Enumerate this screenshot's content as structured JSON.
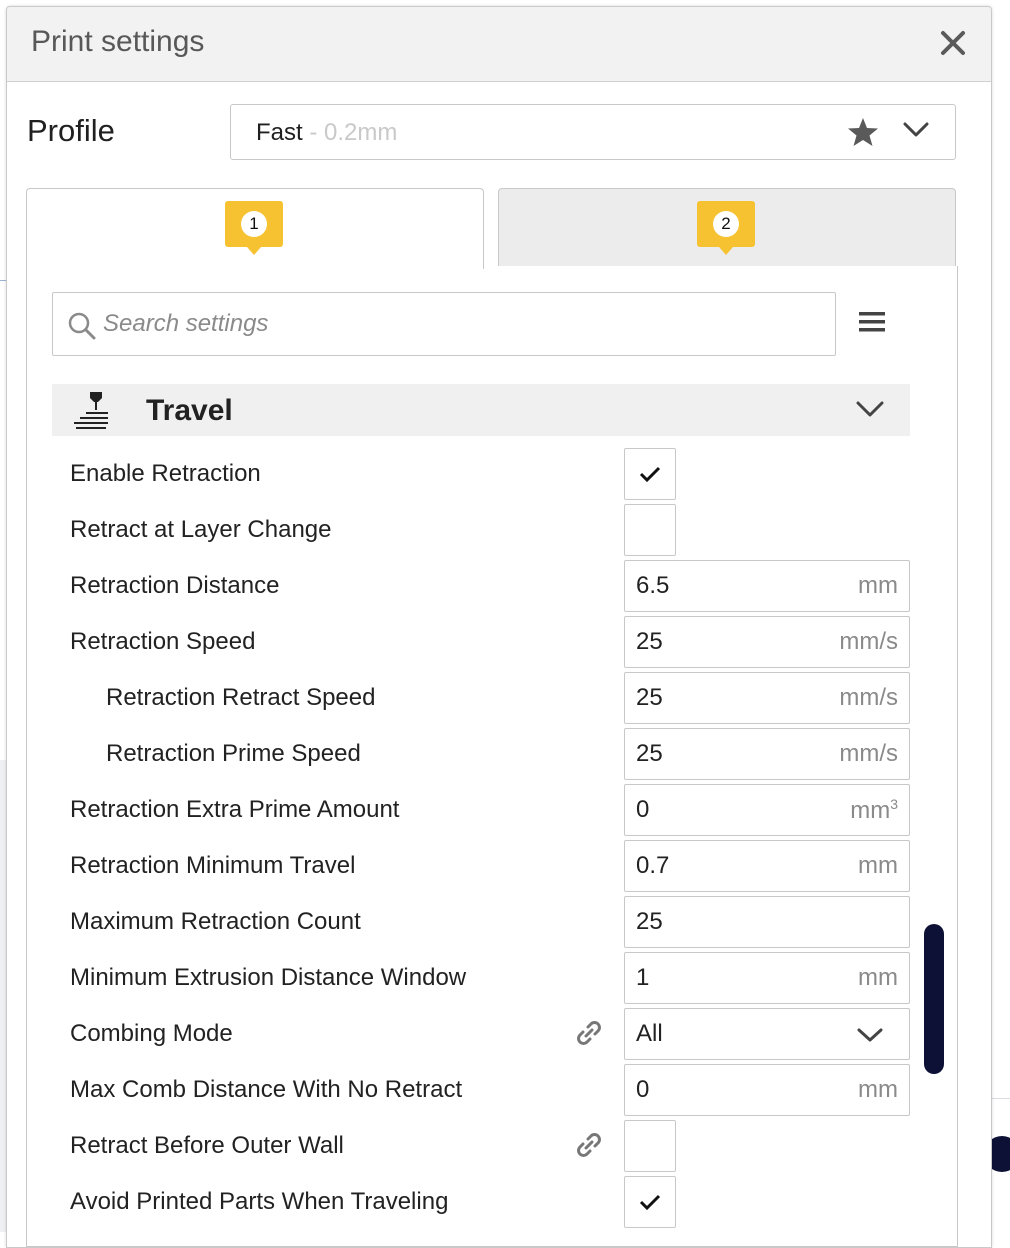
{
  "dialog": {
    "title": "Print settings"
  },
  "profile": {
    "label": "Profile",
    "name": "Fast",
    "separator": " - ",
    "layer_height": "0.2mm"
  },
  "tabs": [
    {
      "number": "1",
      "selected": true
    },
    {
      "number": "2",
      "selected": false
    }
  ],
  "search": {
    "placeholder": "Search settings"
  },
  "category": {
    "title": "Travel",
    "icon": "travel-icon",
    "expanded": true
  },
  "settings": {
    "enable_retraction": {
      "label": "Enable Retraction",
      "checked": true
    },
    "retract_layer_change": {
      "label": "Retract at Layer Change",
      "checked": false
    },
    "retraction_distance": {
      "label": "Retraction Distance",
      "value": "6.5",
      "unit": "mm"
    },
    "retraction_speed": {
      "label": "Retraction Speed",
      "value": "25",
      "unit": "mm/s"
    },
    "retraction_retract_speed": {
      "label": "Retraction Retract Speed",
      "value": "25",
      "unit": "mm/s"
    },
    "retraction_prime_speed": {
      "label": "Retraction Prime Speed",
      "value": "25",
      "unit": "mm/s"
    },
    "retraction_extra_prime": {
      "label": "Retraction Extra Prime Amount",
      "value": "0",
      "unit": "mm",
      "unit_sup": "3"
    },
    "retraction_min_travel": {
      "label": "Retraction Minimum Travel",
      "value": "0.7",
      "unit": "mm"
    },
    "max_retraction_count": {
      "label": "Maximum Retraction Count",
      "value": "25"
    },
    "min_extrusion_window": {
      "label": "Minimum Extrusion Distance Window",
      "value": "1",
      "unit": "mm"
    },
    "combing_mode": {
      "label": "Combing Mode",
      "value": "All"
    },
    "max_comb_distance": {
      "label": "Max Comb Distance With No Retract",
      "value": "0",
      "unit": "mm"
    },
    "retract_before_outer_wall": {
      "label": "Retract Before Outer Wall",
      "checked": false
    },
    "avoid_printed_parts": {
      "label": "Avoid Printed Parts When Traveling",
      "checked": true
    }
  },
  "colors": {
    "badge": "#f6c231",
    "scrollbar": "#0d1136"
  }
}
